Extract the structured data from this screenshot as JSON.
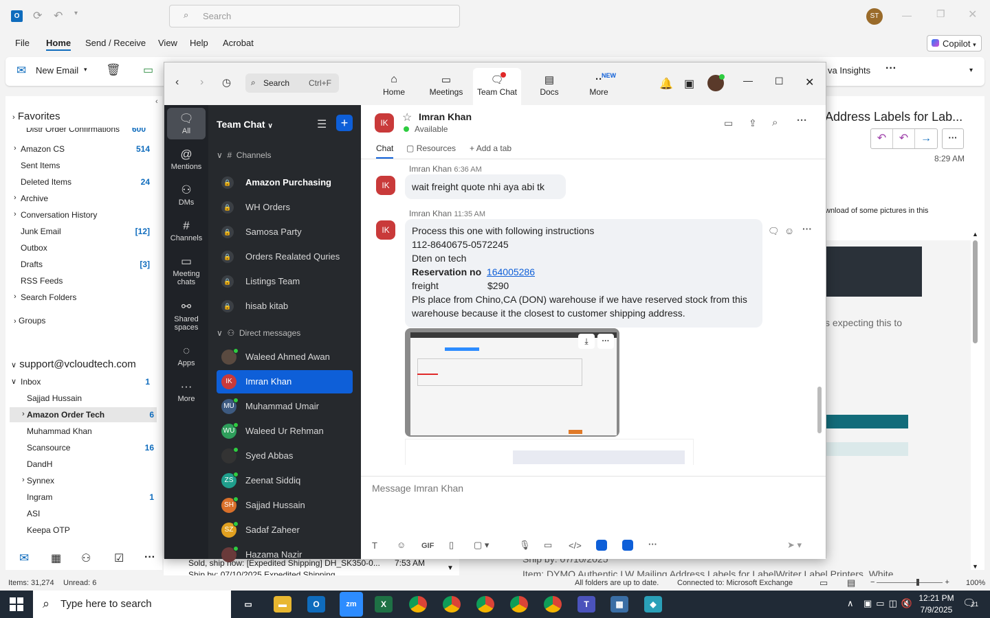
{
  "outlook": {
    "search_placeholder": "Search",
    "user_initials": "ST",
    "ribbon_tabs": [
      "File",
      "Home",
      "Send / Receive",
      "View",
      "Help",
      "Acrobat"
    ],
    "copilot_label": "Copilot",
    "new_email_label": "New Email",
    "insights_label": "va Insights",
    "favorites_label": "Favorites",
    "favorites": [
      {
        "label": "Amazon CS",
        "count": "514",
        "expander": true
      },
      {
        "label": "Sent Items",
        "count": ""
      },
      {
        "label": "Deleted Items",
        "count": "24"
      },
      {
        "label": "Archive",
        "count": "",
        "expander": true
      },
      {
        "label": "Conversation History",
        "count": "",
        "expander": true
      },
      {
        "label": "Junk Email",
        "count": "[12]"
      },
      {
        "label": "Outbox",
        "count": ""
      },
      {
        "label": "Drafts",
        "count": "[3]"
      },
      {
        "label": "RSS Feeds",
        "count": ""
      },
      {
        "label": "Search Folders",
        "count": "",
        "expander": true
      }
    ],
    "partial_top_item": "Distr Order Confirmations",
    "partial_top_count": "600",
    "groups_label": "Groups",
    "account": "support@vcloudtech.com",
    "inbox_label": "Inbox",
    "inbox_count": "1",
    "inbox_children": [
      {
        "label": "Sajjad Hussain",
        "count": ""
      },
      {
        "label": "Amazon Order Tech",
        "count": "6",
        "selected": true,
        "expander": true
      },
      {
        "label": "Muhammad Khan",
        "count": ""
      },
      {
        "label": "Scansource",
        "count": "16"
      },
      {
        "label": "DandH",
        "count": ""
      },
      {
        "label": "Synnex",
        "count": "",
        "expander": true
      },
      {
        "label": "Ingram",
        "count": "1"
      },
      {
        "label": "ASI",
        "count": ""
      },
      {
        "label": "Keepa OTP",
        "count": ""
      }
    ],
    "list_preview_subject": "Sold, ship now: [Expedited Shipping] DH_SK350-0...",
    "list_preview_time": "7:53 AM",
    "list_preview_sub2": "Ship by: 07/10/2025  Expedited Shipping",
    "reading_title": "Address Labels for Lab...",
    "reading_time": "8:29 AM",
    "reading_note": "wnload of some pictures in this",
    "reading_body": "s expecting this to",
    "reading_shipby": "Ship by: 07/10/2025",
    "reading_item": "Item: DYMO Authentic LW Mailing Address Labels for LabelWriter Label Printers, White",
    "status_items": "Items: 31,274",
    "status_unread": "Unread: 6",
    "status_sync": "All folders are up to date.",
    "status_conn": "Connected to: Microsoft Exchange",
    "zoom": "100%"
  },
  "taskbar": {
    "search_placeholder": "Type here to search",
    "time": "12:21 PM",
    "date": "7/9/2025",
    "notif_count": "21"
  },
  "zoom": {
    "search_label": "Search",
    "search_shortcut": "Ctrl+F",
    "nav_tabs": [
      "Home",
      "Meetings",
      "Team Chat",
      "Docs",
      "More"
    ],
    "new_badge": "NEW",
    "rail": [
      "All",
      "Mentions",
      "DMs",
      "Channels",
      "Meeting chats",
      "Shared spaces",
      "Apps",
      "More"
    ],
    "panel_title": "Team Chat",
    "channels_header": "Channels",
    "channels": [
      "Amazon Purchasing",
      "WH Orders",
      "Samosa Party",
      "Orders Realated Quries",
      "Listings Team",
      "hisab kitab"
    ],
    "dm_header": "Direct messages",
    "dms": [
      {
        "name": "Waleed Ahmed Awan",
        "initials": "",
        "color": "#5a4a40"
      },
      {
        "name": "Imran Khan",
        "initials": "IK",
        "color": "#c93a3a"
      },
      {
        "name": "Muhammad Umair",
        "initials": "MU",
        "color": "#3d5a80"
      },
      {
        "name": "Waleed Ur Rehman",
        "initials": "WU",
        "color": "#2e9e5b"
      },
      {
        "name": "Syed Abbas",
        "initials": "",
        "color": "#333"
      },
      {
        "name": "Zeenat Siddiq",
        "initials": "ZS",
        "color": "#1f9e8c"
      },
      {
        "name": "Sajjad Hussain",
        "initials": "SH",
        "color": "#d9702a"
      },
      {
        "name": "Sadaf Zaheer",
        "initials": "SZ",
        "color": "#e0a020"
      },
      {
        "name": "Hazama Nazir",
        "initials": "",
        "color": "#6a3a3a"
      }
    ],
    "contact_name": "Imran Khan",
    "contact_initials": "IK",
    "contact_status": "Available",
    "chat_tabs": [
      "Chat",
      "Resources",
      "Add a tab"
    ],
    "msg1_sender": "Imran Khan",
    "msg1_time": "6:36 AM",
    "msg1_text": "wait freight quote nhi aya abi tk",
    "msg2_sender": "Imran Khan",
    "msg2_time": "11:35 AM",
    "msg2_lines": [
      "Process this one with following instructions",
      "112-8640675-0572245",
      "Dten on tech"
    ],
    "reservation_label": "Reservation no",
    "reservation_link": "164005286",
    "freight_label": "freight",
    "freight_value": "$290",
    "msg2_tail": "Pls place from   Chino,CA (DON) warehouse  if we have reserved stock from this warehouse because it the closest to customer shipping address.",
    "composer_placeholder": "Message Imran Khan",
    "gif_label": "GIF"
  }
}
